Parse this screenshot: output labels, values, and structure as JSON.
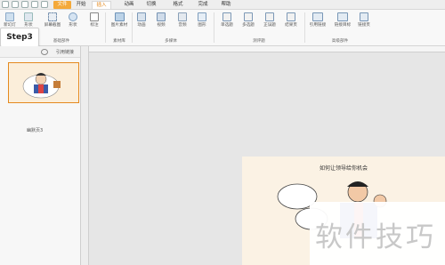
{
  "menu": {
    "tabs": [
      {
        "label": "文件"
      },
      {
        "label": "开始"
      },
      {
        "label": "插入"
      },
      {
        "label": "动画"
      },
      {
        "label": "切换"
      },
      {
        "label": "格式"
      },
      {
        "label": "完成"
      },
      {
        "label": "帮助"
      }
    ],
    "active_tab": "插入"
  },
  "ribbon": {
    "buttons": {
      "new_slide": "新幻灯片",
      "shapes": "形状",
      "screenshot": "屏幕截图",
      "shape_art": "形状",
      "annotation": "标注",
      "image_library": "图片素材",
      "flash": "动画",
      "video": "视频",
      "audio": "音频",
      "chart": "图形",
      "single_choice": "单选题",
      "multi_choice": "多选题",
      "true_false": "正误题",
      "result_page": "结果页",
      "reference_link": "引用链接",
      "link_target": "链接目标",
      "link_page": "链接页"
    },
    "groups": {
      "material_group": "基础部件",
      "image_group": "素材库",
      "media_group": "多媒体",
      "quiz_group": "测评题",
      "advanced_group": "高级部件"
    }
  },
  "step_callout": {
    "label": "Step3"
  },
  "left_panel": {
    "tabs": {
      "quote_link": "引用链接"
    },
    "thumbnail_label": "幽默页3"
  },
  "slide": {
    "title": "如何让领导给你机会"
  },
  "watermark": {
    "text": "软件技巧"
  },
  "colors": {
    "accent": "#e58a1f",
    "file_tab": "#f4a93a",
    "thumb_border": "#e58a1f"
  }
}
